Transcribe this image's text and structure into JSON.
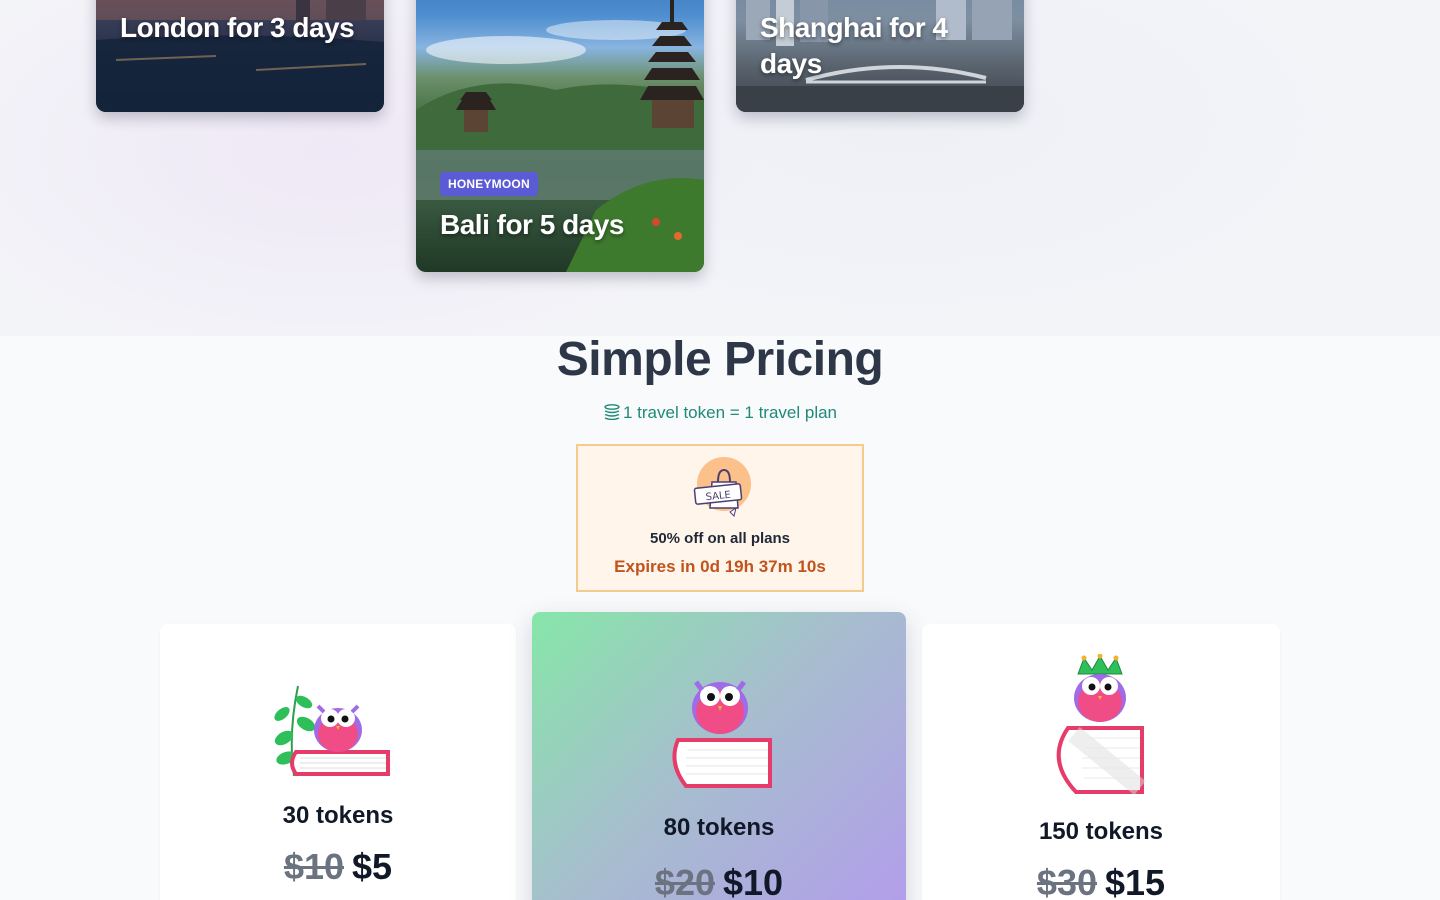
{
  "destinations": [
    {
      "title": "London for 3 days"
    },
    {
      "title": "Bali for 5 days",
      "tag": "HONEYMOON"
    },
    {
      "title": "Shanghai for 4 days"
    }
  ],
  "pricing": {
    "title": "Simple Pricing",
    "subtitle": "1 travel token = 1 travel plan",
    "sale": {
      "icon_label": "SALE",
      "text": "50% off on all plans",
      "expires": "Expires in 0d 19h 37m 10s"
    },
    "plans": [
      {
        "tokens": "30 tokens",
        "old_price": "$10",
        "price": "$5"
      },
      {
        "tokens": "80 tokens",
        "old_price": "$20",
        "price": "$10"
      },
      {
        "tokens": "150 tokens",
        "old_price": "$30",
        "price": "$15"
      }
    ]
  },
  "colors": {
    "accent_tag": "#5b5bd6",
    "subtitle_teal": "#1f8a79",
    "sale_border": "#f6c98f",
    "sale_bg": "#fff5eb",
    "expire_orange": "#c0541c"
  }
}
